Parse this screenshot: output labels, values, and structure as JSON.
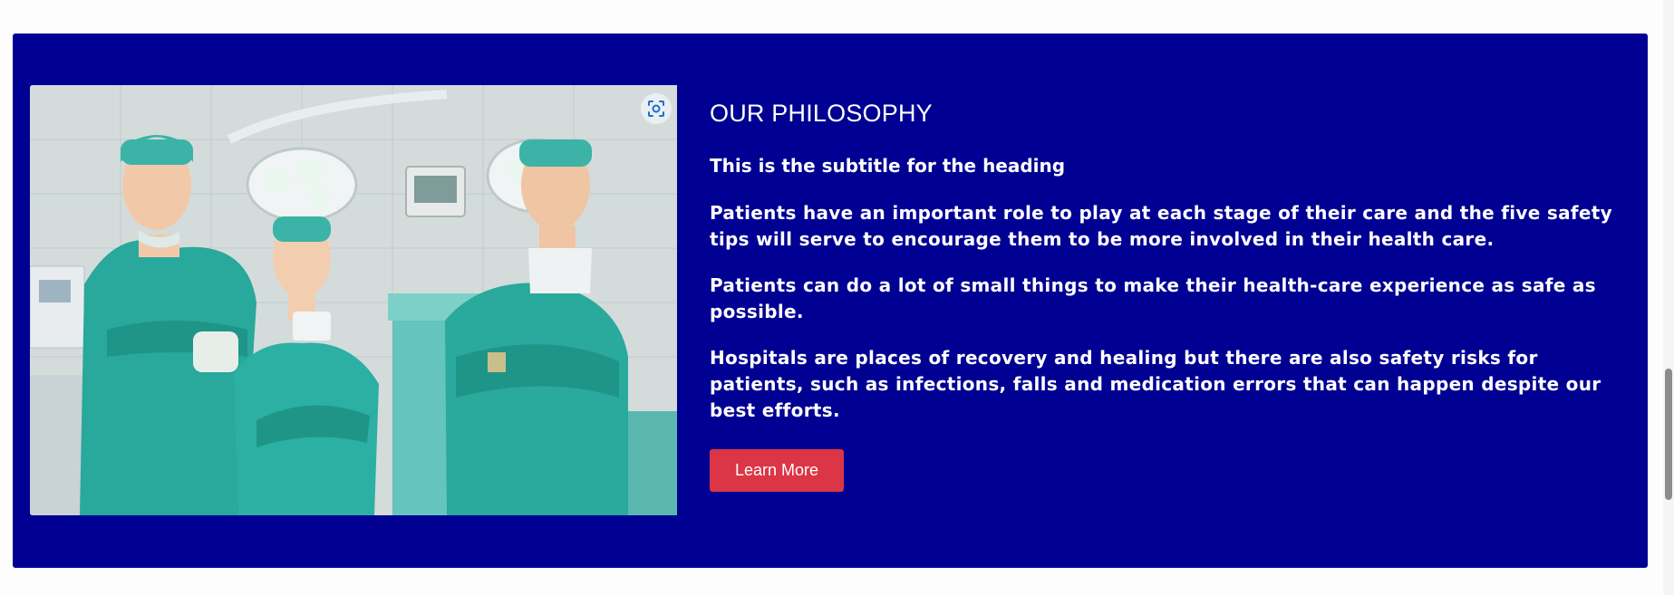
{
  "section": {
    "heading": "OUR PHILOSOPHY",
    "subtitle": "This is the subtitle for the heading",
    "paragraphs": [
      "Patients have an important role to play at each stage of their care and the five safety tips will serve to encourage them to be more involved in their health care.",
      "Patients can do a lot of small things to make their health-care experience as safe as possible.",
      "Hospitals are places of recovery and healing but there are also safety risks for patients, such as infections, falls and medication errors that can happen despite our best efforts."
    ],
    "button_label": "Learn More",
    "image_icon": "lens-search-icon"
  },
  "colors": {
    "panel_bg": "#000092",
    "button_bg": "#dc3545",
    "text": "#ffffff"
  }
}
